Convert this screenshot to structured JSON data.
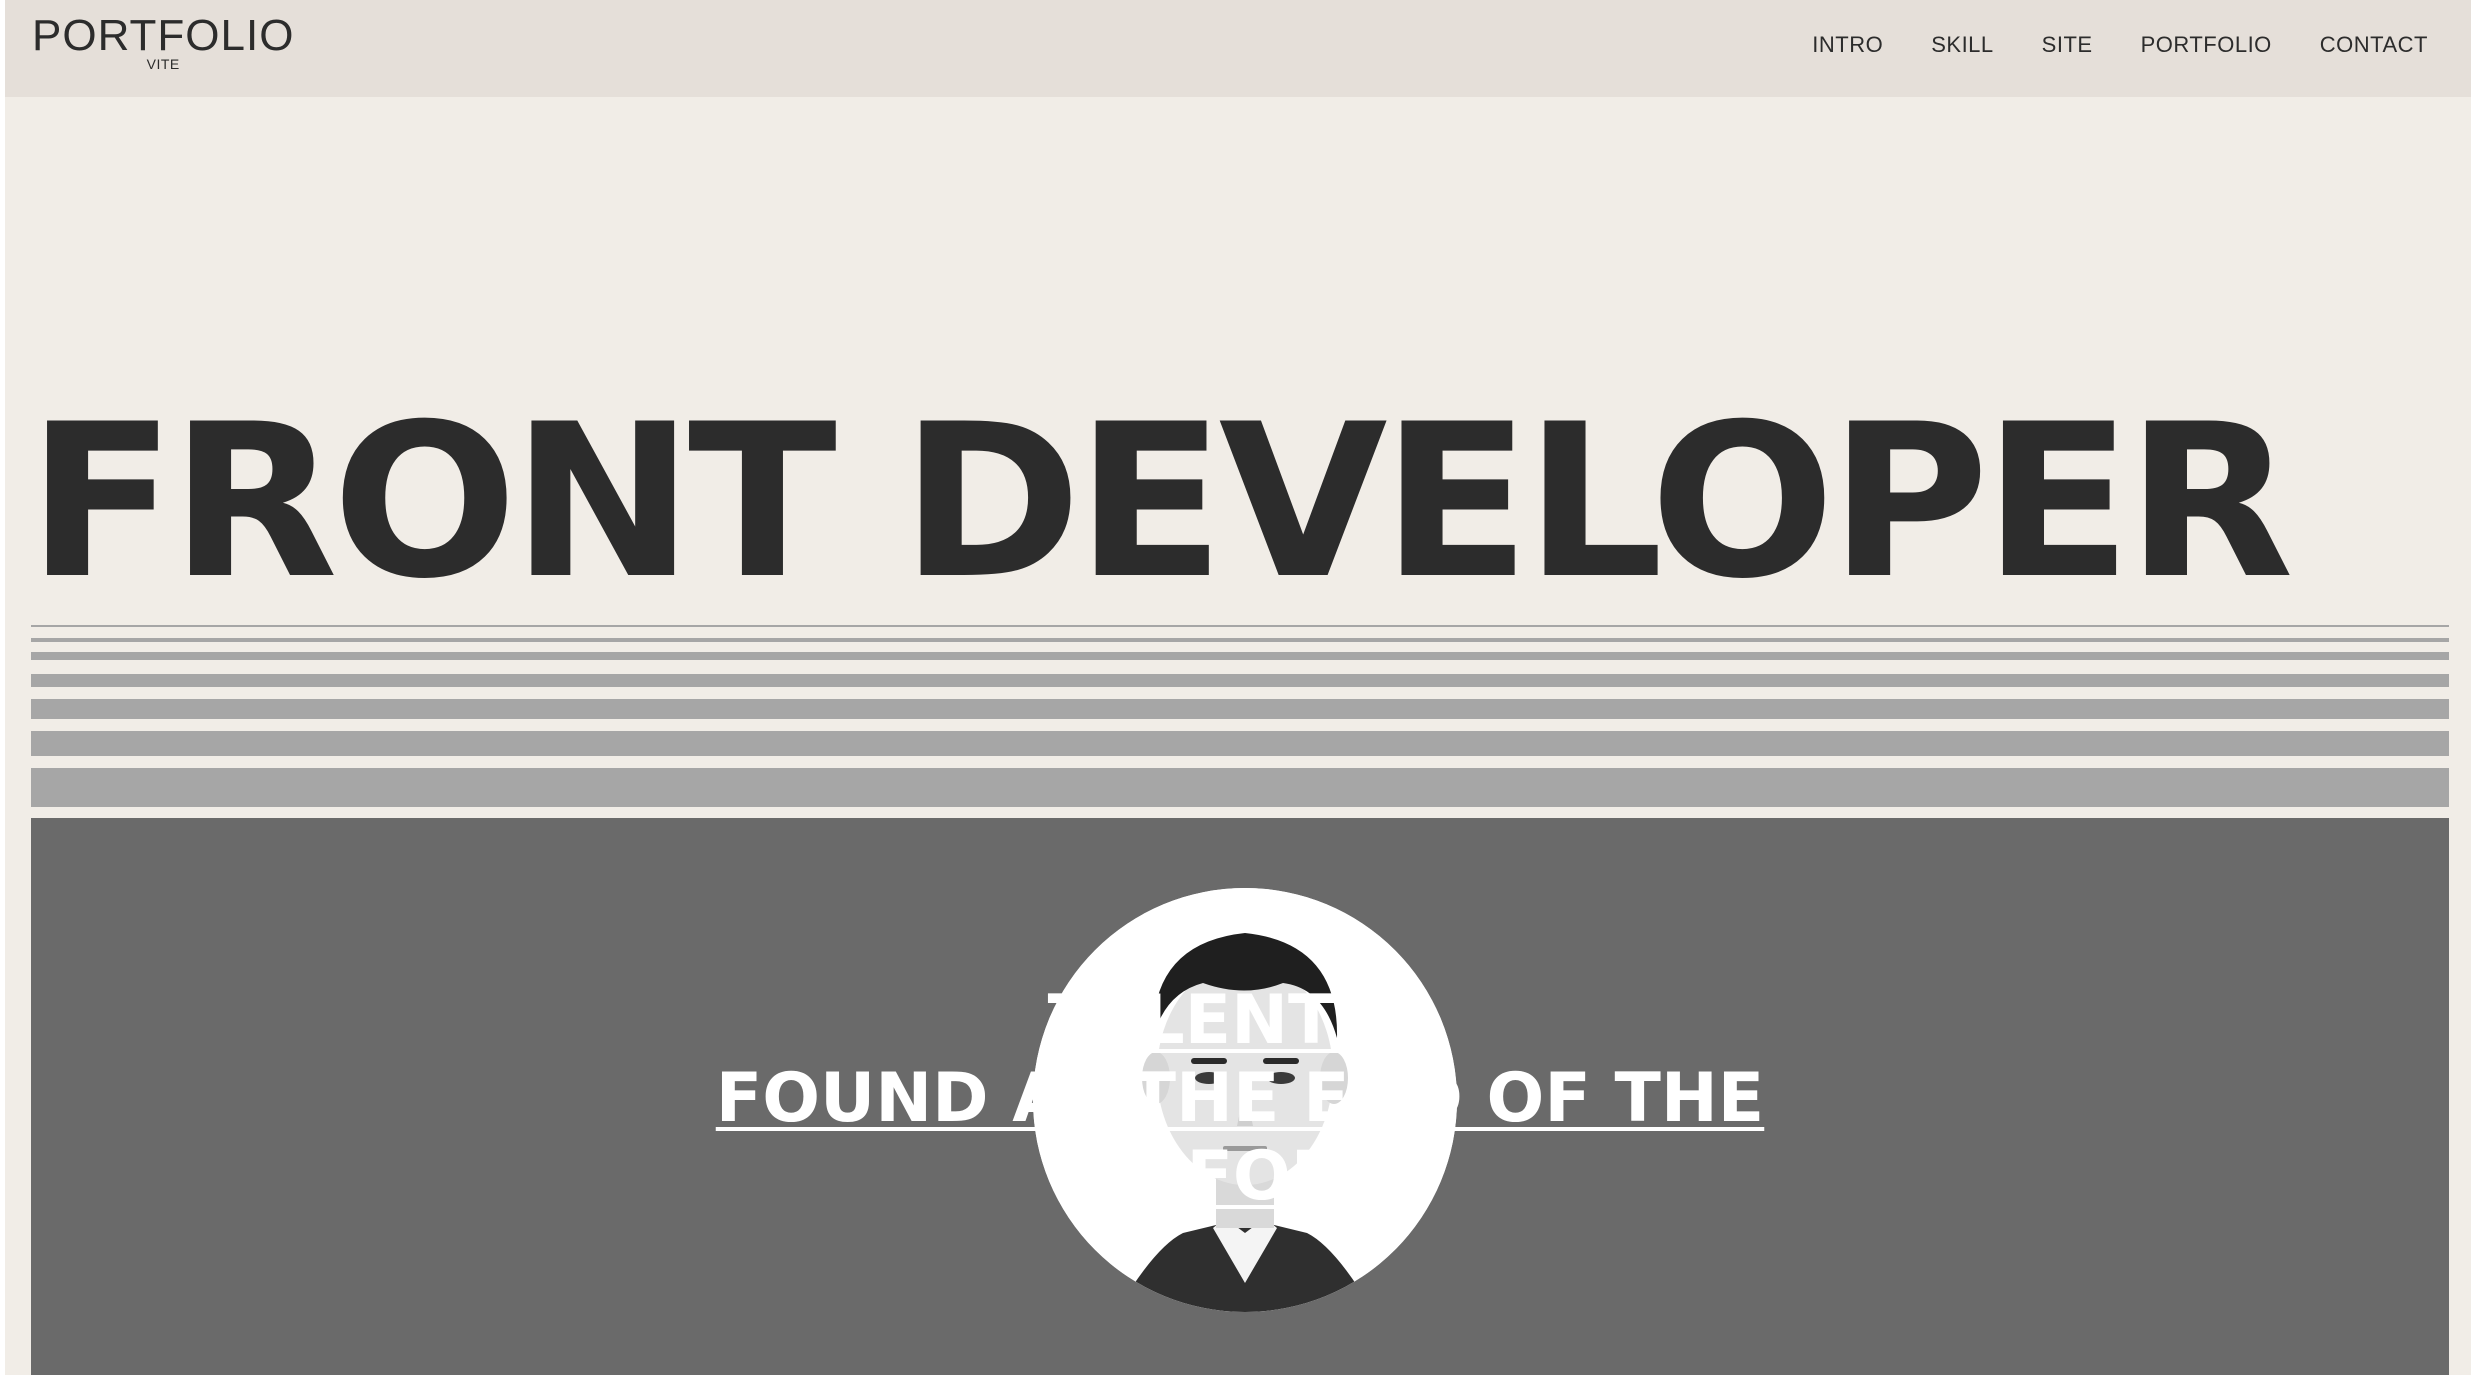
{
  "header": {
    "logo_title": "PORTFOLIO",
    "logo_subtitle": "VITE",
    "nav": [
      {
        "label": "INTRO"
      },
      {
        "label": "SKILL"
      },
      {
        "label": "SITE"
      },
      {
        "label": "PORTFOLIO"
      },
      {
        "label": "CONTACT"
      }
    ]
  },
  "hero": {
    "headline": "FRONT DEVELOPER"
  },
  "intro": {
    "quote_line1": "TALENT IS",
    "quote_line2": "FOUND AT THE END OF THE",
    "quote_line3": "EFFORT",
    "photo_icon": "profile-photo"
  },
  "colors": {
    "background": "#f1ede7",
    "header": "#e5dfd9",
    "text": "#2c2c2c",
    "stripes": "#a6a6a6",
    "intro_bg": "#6a6a6a"
  }
}
